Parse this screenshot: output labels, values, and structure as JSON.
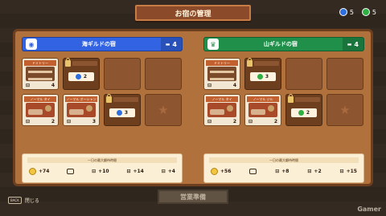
{
  "header": {
    "title": "お宿の管理"
  },
  "gems": [
    {
      "icon": "blue-gem-icon",
      "count": "5",
      "color": "#2e6fe0"
    },
    {
      "icon": "green-gem-icon",
      "count": "5",
      "color": "#2fae44"
    }
  ],
  "inns": [
    {
      "name": "海ギルドの宿",
      "capacity": "4",
      "color": "#3163e3",
      "icon": "fish-icon",
      "rooms": [
        {
          "type": "filled",
          "title": "ドミトリー",
          "img": "bunk",
          "capacity": "4"
        },
        {
          "type": "locked",
          "cost": "2",
          "gem_color": "#2e6fe0"
        },
        {
          "type": "empty"
        },
        {
          "type": "empty"
        },
        {
          "type": "filled",
          "title": "ノーマル タイ",
          "img": "lux",
          "capacity": "2"
        },
        {
          "type": "filled",
          "title": "ノーマル オーシャン",
          "img": "lux",
          "capacity": "3"
        },
        {
          "type": "locked",
          "cost": "3",
          "gem_color": "#2e6fe0"
        },
        {
          "type": "star"
        }
      ],
      "wait": {
        "title": "一日の最大顧待時間",
        "coin": "+74",
        "v1": "+10",
        "v2": "+14",
        "v3": "+4"
      }
    },
    {
      "name": "山ギルドの宿",
      "capacity": "4",
      "color": "#1f8f49",
      "icon": "crown-icon",
      "rooms": [
        {
          "type": "filled",
          "title": "ドミトリー",
          "img": "bunk",
          "capacity": "4"
        },
        {
          "type": "locked",
          "cost": "3",
          "gem_color": "#2fae44"
        },
        {
          "type": "empty"
        },
        {
          "type": "empty"
        },
        {
          "type": "filled",
          "title": "ノーマル タイ",
          "img": "lux",
          "capacity": "2"
        },
        {
          "type": "filled",
          "title": "ノーマル ジル",
          "img": "lux",
          "capacity": "2"
        },
        {
          "type": "locked",
          "cost": "2",
          "gem_color": "#2fae44"
        },
        {
          "type": "star"
        }
      ],
      "wait": {
        "title": "一日の最大顧待時間",
        "coin": "+56",
        "v1": "+8",
        "v2": "+2",
        "v3": "+15"
      }
    }
  ],
  "footer": {
    "prepare_label": "営業準備",
    "close_label": "閉じる",
    "close_key": "BACK",
    "watermark": "Gamer"
  }
}
